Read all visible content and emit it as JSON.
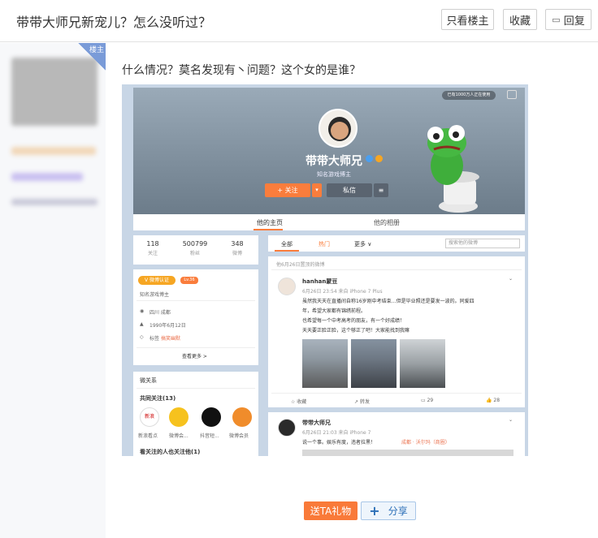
{
  "header": {
    "title": "带带大师兄新宠儿？怎么没听过？",
    "buttons": {
      "only_op": "只看楼主",
      "favorite": "收藏",
      "reply": "回复"
    }
  },
  "side": {
    "badge": "楼主"
  },
  "post": {
    "text": "什么情况？莫名发现有丶问题？这个女的是谁？"
  },
  "screenshot": {
    "cover_notice": "已有1000万人正在使用",
    "profile": {
      "name": "带带大师兄",
      "subtitle": "知名游戏博主",
      "follow": "+ 关注",
      "message": "私信",
      "more": "≡",
      "dropdown": "▾"
    },
    "tabs": {
      "home": "他的主页",
      "album": "他的相册"
    },
    "stats": [
      {
        "value": "118",
        "label": "关注"
      },
      {
        "value": "500799",
        "label": "粉丝"
      },
      {
        "value": "348",
        "label": "微博"
      }
    ],
    "info": {
      "verify_badge": "V 微博认证",
      "level": "Lv.36",
      "desc": "知名游戏博主",
      "location": "四川 成都",
      "birthday": "1990年6月12日",
      "tags_label": "标签",
      "tags": "搞笑幽默",
      "view_more": "查看更多 >"
    },
    "relations": {
      "title": "微关系",
      "common_follow": "共同关注(13)",
      "accounts": [
        "新浪看点",
        "微博会...",
        "抖音短...",
        "微博会员"
      ],
      "bottom": "看关注的人也关注他(1)"
    },
    "feed": {
      "tabs": {
        "all": "全部",
        "hot": "热门",
        "more": "更多 ∨"
      },
      "search_placeholder": "搜索他的微博",
      "pinned": "他6月26日置顶的微博",
      "post1": {
        "user": "hanhan蒙豆",
        "time": "6月26日 23:54 来自 iPhone 7 Plus",
        "lines": [
          "虽然我天天在直播间自称16岁刚中考结束…但是毕业照还是要发一波的。同爱四",
          "年，希望大家都有锦绣前程。",
          "也希望每一个中考高考的朋友，有一个好成绩！",
          "天天要正脸正脸，这个够正了吧！大家能找到我嘛"
        ],
        "actions": {
          "fav": "收藏",
          "forward": "转发",
          "comment": "29",
          "like": "28"
        }
      },
      "post2": {
        "user": "带带大师兄",
        "time": "6月26日 21:03 来自 iPhone 7",
        "text": "说一个事。娱乐有度，违者拉黑！",
        "loc": "成都 · 沃尔玛（商圈）"
      }
    }
  },
  "footer": {
    "gift": "送TA礼物",
    "share": "分享"
  },
  "colors": {
    "accent": "#fa7d3c",
    "link": "#2c6fb7",
    "sidebar": "#f7f8fa"
  }
}
